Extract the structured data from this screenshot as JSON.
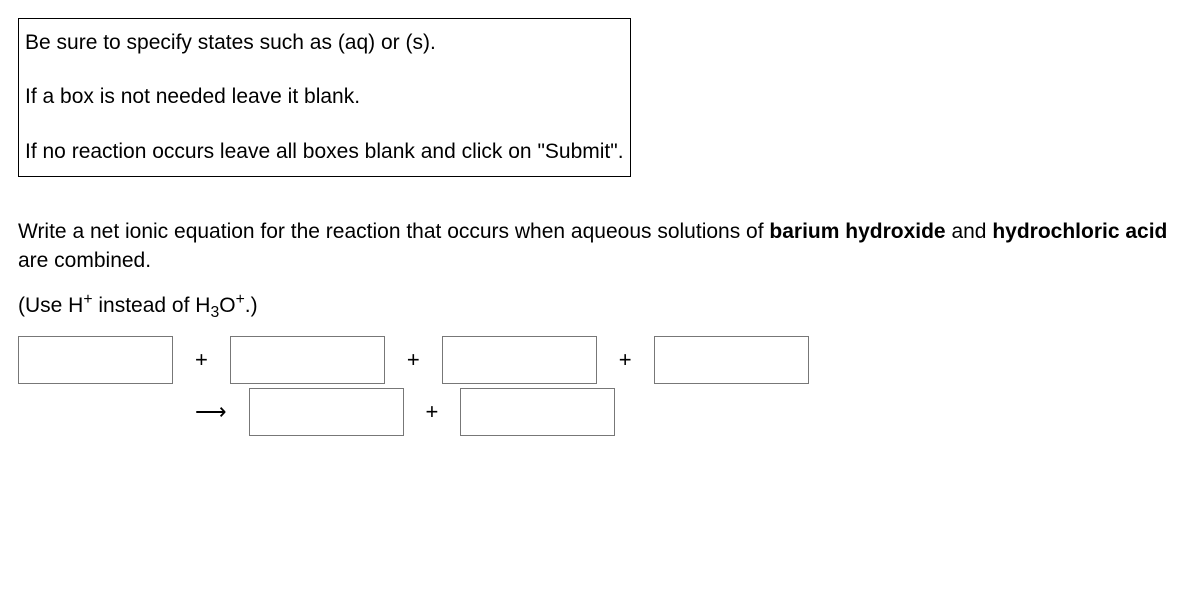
{
  "instructions": {
    "line1": "Be sure to specify states such as (aq) or (s).",
    "line2": "If a box is not needed leave it blank.",
    "line3": "If no reaction occurs leave all boxes blank and click on \"Submit\"."
  },
  "question": {
    "prefix": "Write a net ionic equation for the reaction that occurs when aqueous solutions of ",
    "chem1": "barium hydroxide",
    "mid": " and ",
    "chem2": "hydrochloric acid",
    "suffix": " are combined."
  },
  "hint": {
    "prefix": "(Use H",
    "sup1": "+",
    "mid": " instead of H",
    "sub1": "3",
    "mid2": "O",
    "sup2": "+",
    "suffix": ".)"
  },
  "operators": {
    "plus": "+",
    "arrow": "⟶"
  },
  "inputs": {
    "reactant1": "",
    "reactant2": "",
    "reactant3": "",
    "reactant4": "",
    "product1": "",
    "product2": ""
  }
}
